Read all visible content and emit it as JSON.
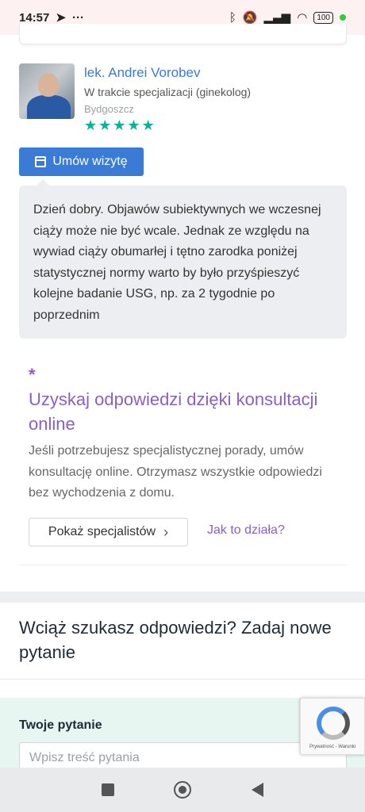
{
  "status_bar": {
    "time": "14:57",
    "battery": "100"
  },
  "doctor": {
    "name": "lek. Andrei Vorobev",
    "specialization": "W trakcie specjalizacji (ginekolog)",
    "city": "Bydgoszcz",
    "rating_stars": 5,
    "visit_button_label": "Umów wizytę"
  },
  "answer": {
    "text": "Dzień dobry. Objawów subiektywnych we wczesnej ciąży może nie być wcale. Jednak ze względu na wywiad ciąży obumarłej i tętno zarodka poniżej statystycznej normy warto by było przyśpieszyć kolejne badanie USG, np. za 2 tygodnie po poprzednim"
  },
  "promo": {
    "title": "Uzyskaj odpowiedzi dzięki konsultacji online",
    "text": "Jeśli potrzebujesz specjalistycznej porady, umów konsultację online. Otrzymasz wszystkie odpowiedzi bez wychodzenia z domu.",
    "button_label": "Pokaż specjalistów",
    "link_label": "Jak to działa?"
  },
  "ask": {
    "title": "Wciąż szukasz odpowiedzi? Zadaj nowe pytanie",
    "label": "Twoje pytanie",
    "placeholder": "Wpisz treść pytania"
  },
  "recaptcha": {
    "text": "Prywatność - Warunki"
  },
  "colors": {
    "accent_blue": "#3a7bd5",
    "accent_purple": "#8b5fc7",
    "star_green": "#00b39b"
  }
}
